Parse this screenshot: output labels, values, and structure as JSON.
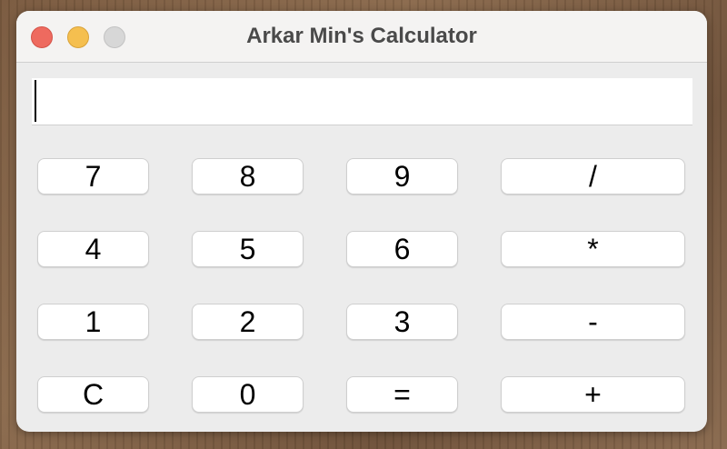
{
  "window": {
    "title": "Arkar Min's Calculator"
  },
  "display": {
    "value": ""
  },
  "buttons": {
    "seven": "7",
    "eight": "8",
    "nine": "9",
    "divide": "/",
    "four": "4",
    "five": "5",
    "six": "6",
    "multiply": "*",
    "one": "1",
    "two": "2",
    "three": "3",
    "subtract": "-",
    "clear": "C",
    "zero": "0",
    "equals": "=",
    "add": "+"
  },
  "colors": {
    "close": "#ee6a5f",
    "minimize": "#f5bf4f",
    "maximize": "#d7d7d7",
    "window_bg": "#ececec",
    "button_bg": "#ffffff"
  },
  "icons": {
    "close": "close-icon",
    "minimize": "minimize-icon",
    "maximize": "maximize-icon"
  }
}
